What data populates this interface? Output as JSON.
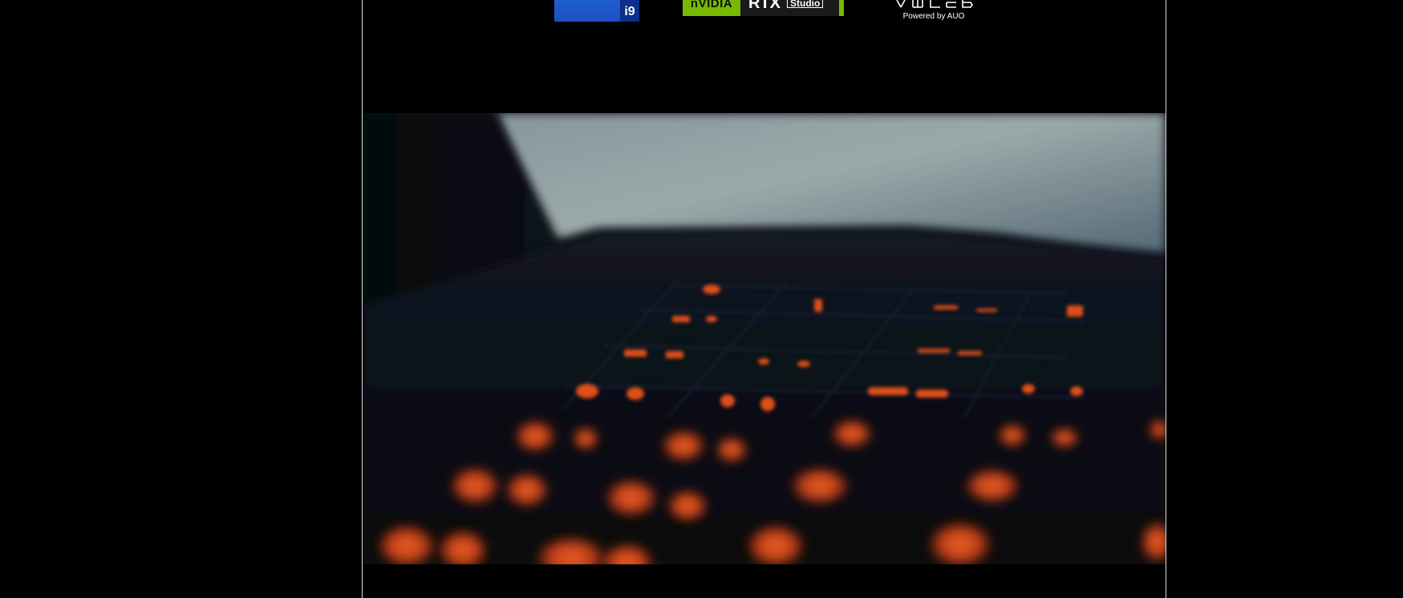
{
  "badges": {
    "intel": {
      "model_label": "i9",
      "color": "#1d4fc0"
    },
    "nvidia": {
      "brand_label": "nVIDIA",
      "product_label": "RTX",
      "studio_label": "Studio",
      "color": "#76b900"
    },
    "xmled": {
      "tagline": "Powered by AUO"
    }
  },
  "hero": {
    "subject": "backlit laptop keyboard",
    "accent_color": "#ff5a1e"
  }
}
